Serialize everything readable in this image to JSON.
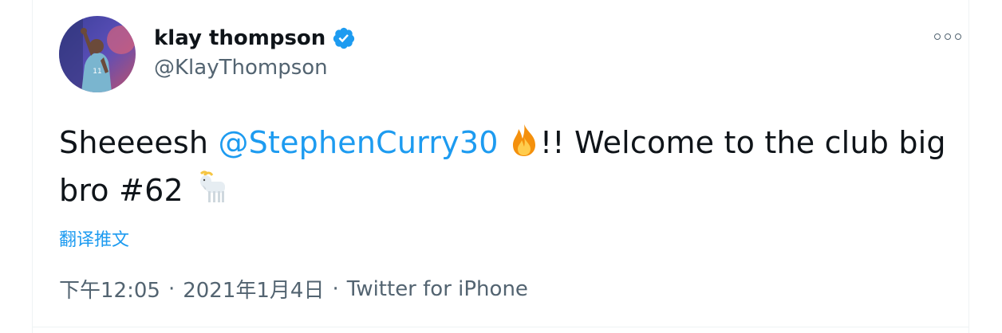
{
  "tweet": {
    "author": {
      "display_name": "klay thompson",
      "handle": "@KlayThompson",
      "verified": true
    },
    "text_before": "Sheeeesh ",
    "mention": "@StephenCurry30",
    "emoji_1": "fire-emoji",
    "text_middle": "!! Welcome to the club big bro #62",
    "emoji_2": "goat-emoji",
    "translate_label": "翻译推文",
    "time": "下午12:05",
    "date": "2021年1月4日",
    "separator": "·",
    "source": "Twitter for iPhone"
  },
  "colors": {
    "accent": "#1d9bf0",
    "text": "#0f1419",
    "secondary": "#536471"
  }
}
